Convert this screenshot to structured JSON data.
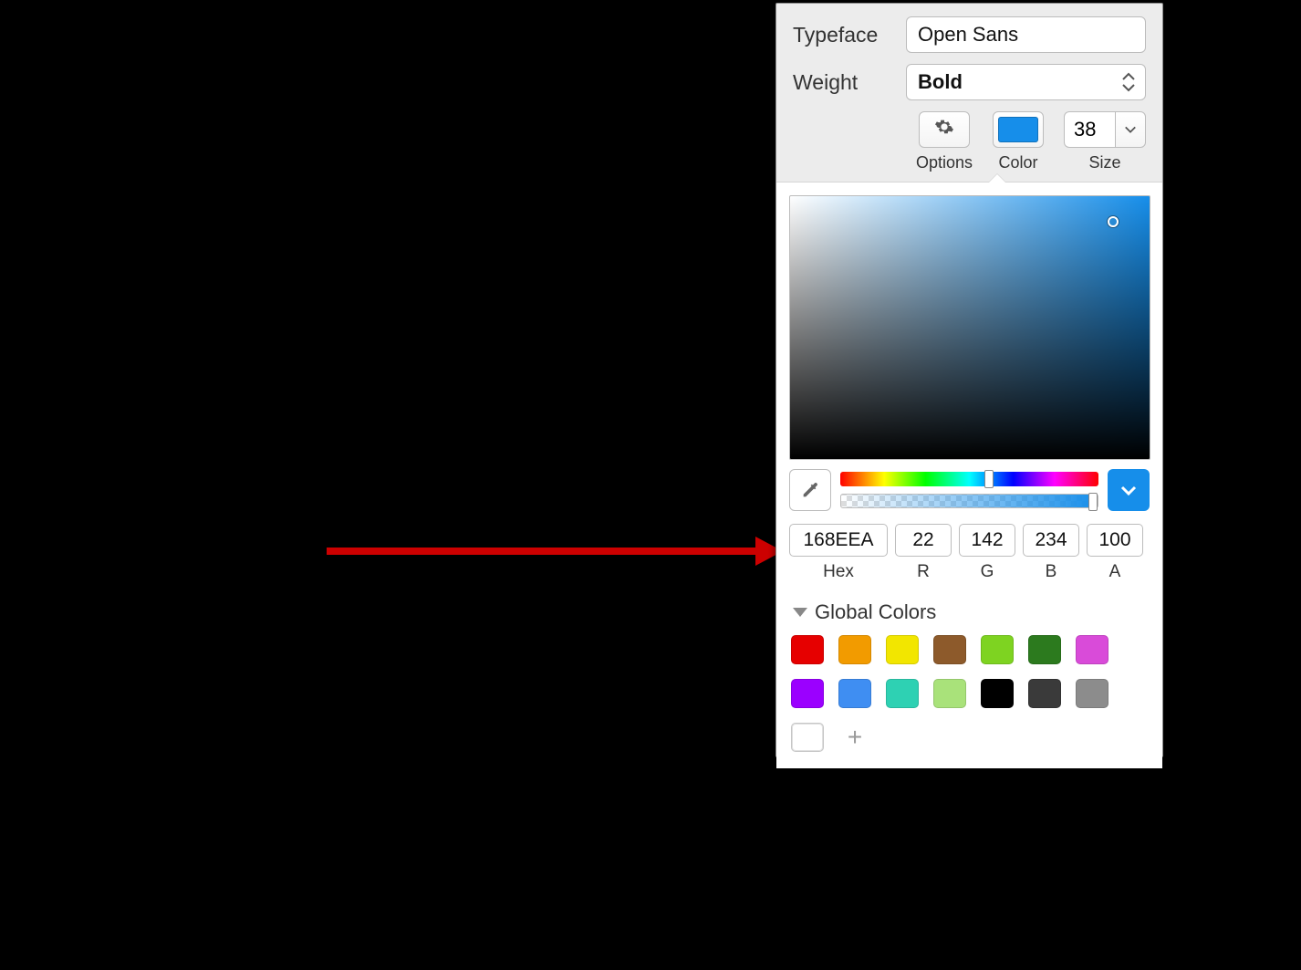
{
  "annotation": {
    "arrow_color": "#cc0000"
  },
  "typography": {
    "typeface_label": "Typeface",
    "typeface_value": "Open Sans",
    "weight_label": "Weight",
    "weight_value": "Bold",
    "options_caption": "Options",
    "color_caption": "Color",
    "size_caption": "Size",
    "size_value": "38"
  },
  "color_picker": {
    "selected_hex": "168EEA",
    "r": "22",
    "g": "142",
    "b": "234",
    "a": "100",
    "labels": {
      "hex": "Hex",
      "r": "R",
      "g": "G",
      "b": "B",
      "a": "A"
    }
  },
  "global_colors": {
    "header": "Global Colors",
    "swatches": [
      "#e60000",
      "#f29b00",
      "#f2e600",
      "#8d5a2b",
      "#7ed321",
      "#2c7a1e",
      "#d94bd9",
      "#9b00ff",
      "#3f8ef2",
      "#2ed1b3",
      "#a9e27a",
      "#000000",
      "#3a3a3a",
      "#8c8c8c",
      "#ffffff"
    ]
  }
}
